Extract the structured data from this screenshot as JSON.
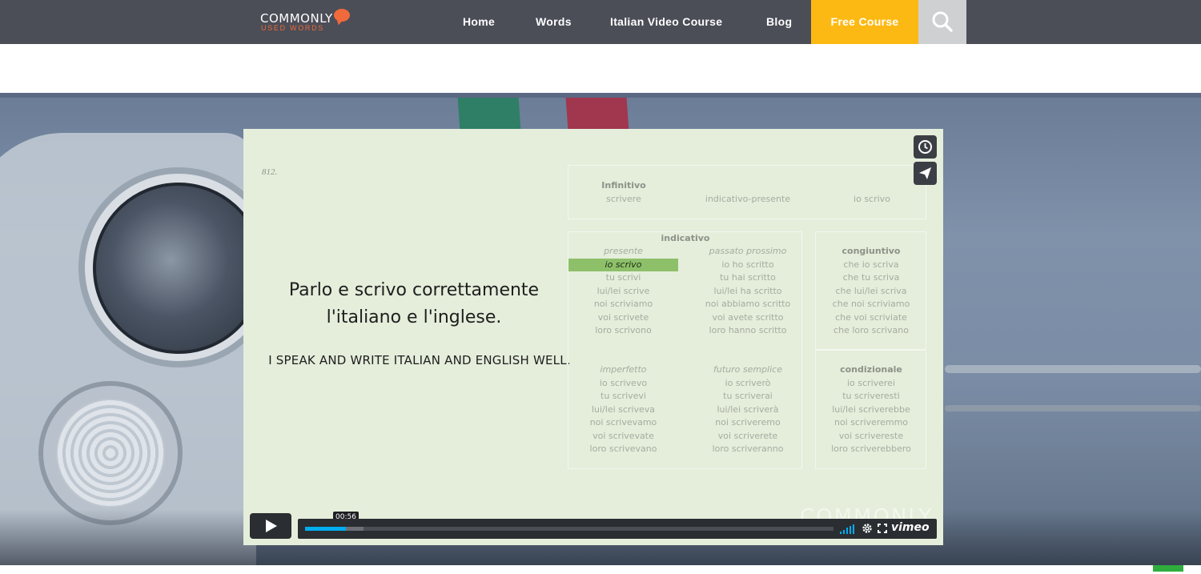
{
  "brand": {
    "logo_top": "COMMONLY",
    "logo_bottom": "USED WORDS",
    "accent_color": "#f06a3b"
  },
  "nav": {
    "items": [
      {
        "label": "Home"
      },
      {
        "label": "Words"
      },
      {
        "label": "Italian Video Course"
      },
      {
        "label": "Blog"
      }
    ],
    "cta_label": "Free Course",
    "cta_color": "#fdb913",
    "search_icon": "search-icon"
  },
  "video": {
    "slide_number": "812.",
    "sentence_line1": "Parlo e scrivo correttamente",
    "sentence_line2": "l'italiano e l'inglese.",
    "translation": "I SPEAK AND WRITE ITALIAN AND ENGLISH WELL.",
    "header": {
      "infinitive_label": "Infinitivo",
      "infinitive_value": "scrivere",
      "tense": "indicativo-presente",
      "form": "io scrivo"
    },
    "indicativo_title": "indicativo",
    "presente": {
      "title": "presente",
      "forms": [
        "io scrivo",
        "tu scrivi",
        "lui/lei scrive",
        "noi scriviamo",
        "voi scrivete",
        "loro scrivono"
      ]
    },
    "passato_prossimo": {
      "title": "passato prossimo",
      "forms": [
        "io ho scritto",
        "tu hai scritto",
        "lui/lei ha scritto",
        "noi abbiamo scritto",
        "voi avete scritto",
        "loro hanno scritto"
      ]
    },
    "imperfetto": {
      "title": "imperfetto",
      "forms": [
        "io scrivevo",
        "tu scrivevi",
        "lui/lei scriveva",
        "noi scrivevamo",
        "voi scrivevate",
        "loro scrivevano"
      ]
    },
    "futuro_semplice": {
      "title": "futuro semplice",
      "forms": [
        "io scriverò",
        "tu scriverai",
        "lui/lei scriverà",
        "noi scriveremo",
        "voi scriverete",
        "loro scriveranno"
      ]
    },
    "congiuntivo": {
      "title": "congiuntivo",
      "forms": [
        "che io scriva",
        "che tu scriva",
        "che lui/lei scriva",
        "che noi scriviamo",
        "che voi scriviate",
        "che loro scrivano"
      ]
    },
    "condizionale": {
      "title": "condizionale",
      "forms": [
        "io scriverei",
        "tu scriveresti",
        "lui/lei scriverebbe",
        "noi scriveremmo",
        "voi scrivereste",
        "loro scriverebbero"
      ]
    },
    "player": {
      "time": "00:56",
      "progress_fraction": 0.078,
      "brand": "vimeo",
      "watermark": "COMMONLY",
      "accent_color": "#00adef"
    }
  }
}
